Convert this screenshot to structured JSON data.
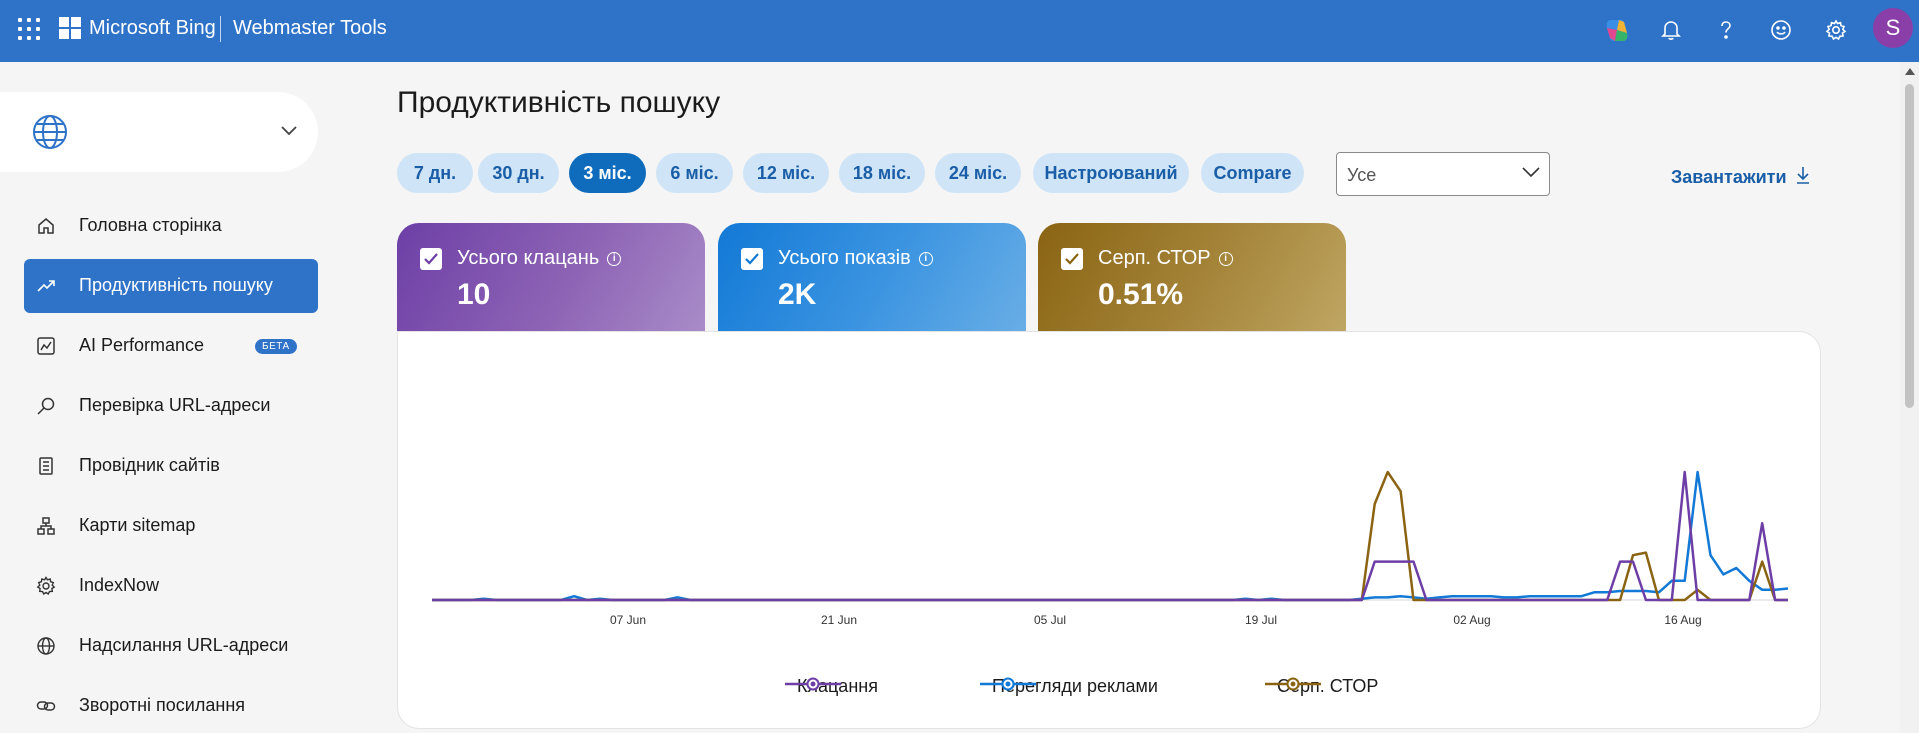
{
  "header": {
    "brand": "Microsoft Bing",
    "product": "Webmaster Tools",
    "avatar_initial": "S",
    "icons": [
      "waffle-icon",
      "copilot-icon",
      "bell-icon",
      "help-icon",
      "feedback-smiley-icon",
      "settings-gear-icon"
    ]
  },
  "sidebar": {
    "site_selector_icon": "globe-icon",
    "items": [
      {
        "label": "Головна сторінка",
        "icon": "home-icon"
      },
      {
        "label": "Продуктивність пошуку",
        "icon": "trend-icon",
        "active": true
      },
      {
        "label": "AI Performance",
        "icon": "ai-performance-icon",
        "badge": "БЕТА"
      },
      {
        "label": "Перевірка URL-адреси",
        "icon": "search-icon"
      },
      {
        "label": "Провідник сайтів",
        "icon": "site-explorer-icon"
      },
      {
        "label": "Карти sitemap",
        "icon": "sitemap-icon"
      },
      {
        "label": "IndexNow",
        "icon": "gear-icon"
      },
      {
        "label": "Надсилання URL-адреси",
        "icon": "globe-icon"
      },
      {
        "label": "Зворотні посилання",
        "icon": "link-icon"
      }
    ]
  },
  "main": {
    "title": "Продуктивність пошуку",
    "ranges": [
      "7 дн.",
      "30 дн.",
      "3 міс.",
      "6 міс.",
      "12 міс.",
      "18 міс.",
      "24 міс.",
      "Настроюваний",
      "Compare"
    ],
    "active_range": "3 міс.",
    "filter_value": "Усе",
    "download_label": "Завантажити",
    "metrics": [
      {
        "label": "Усього клацань",
        "value": "10",
        "checked": true,
        "color": "#6d3fa6"
      },
      {
        "label": "Усього показів",
        "value": "2K",
        "checked": true,
        "color": "#1279d6"
      },
      {
        "label": "Серп. СТОР",
        "value": "0.51%",
        "checked": true,
        "color": "#8a6413"
      }
    ]
  },
  "chart_data": {
    "type": "line",
    "x_ticks": [
      "07 Jun",
      "21 Jun",
      "05 Jul",
      "19 Jul",
      "02 Aug",
      "16 Aug"
    ],
    "grid": false,
    "legend_position": "bottom-center",
    "series": [
      {
        "name": "Клацання",
        "color": "#6d3fa6",
        "values": [
          0,
          0,
          0,
          0,
          0,
          0,
          0,
          0,
          0,
          0,
          0,
          0,
          0,
          0,
          0,
          0,
          0,
          0,
          0,
          0,
          0,
          0,
          0,
          0,
          0,
          0,
          0,
          0,
          0,
          0,
          0,
          0,
          0,
          0,
          0,
          0,
          0,
          0,
          0,
          0,
          0,
          0,
          0,
          0,
          0,
          0,
          0,
          0,
          0,
          0,
          0,
          0,
          0,
          0,
          0,
          0,
          0,
          0,
          0,
          0,
          0,
          0,
          0,
          0,
          0,
          0,
          0,
          0,
          0,
          0,
          0,
          0,
          0,
          0.3,
          0.3,
          0.3,
          0.3,
          0,
          0,
          0,
          0,
          0,
          0,
          0,
          0,
          0,
          0,
          0,
          0,
          0,
          0,
          0,
          0.3,
          0.3,
          0,
          0,
          0,
          1,
          0,
          0,
          0,
          0,
          0,
          0.6,
          0,
          0
        ]
      },
      {
        "name": "Перегляди реклами",
        "color": "#1279d6",
        "values": [
          0,
          0,
          0,
          0,
          0.01,
          0,
          0,
          0,
          0,
          0,
          0,
          0.03,
          0,
          0.01,
          0,
          0,
          0,
          0,
          0,
          0.02,
          0,
          0,
          0,
          0,
          0,
          0,
          0,
          0,
          0,
          0,
          0,
          0,
          0,
          0,
          0,
          0,
          0,
          0,
          0,
          0,
          0,
          0,
          0,
          0,
          0,
          0,
          0,
          0,
          0,
          0,
          0,
          0,
          0,
          0,
          0,
          0,
          0,
          0,
          0,
          0,
          0,
          0,
          0,
          0.01,
          0,
          0.01,
          0,
          0,
          0,
          0,
          0,
          0,
          0.01,
          0.02,
          0.02,
          0.03,
          0.02,
          0.01,
          0.02,
          0.03,
          0.03,
          0.03,
          0.03,
          0.02,
          0.02,
          0.03,
          0.03,
          0.03,
          0.03,
          0.03,
          0.06,
          0.06,
          0.07,
          0.07,
          0.07,
          0.06,
          0.15,
          0.15,
          1,
          0.35,
          0.2,
          0.25,
          0.15,
          0.08,
          0.08,
          0.09
        ]
      },
      {
        "name": "Серп. СТОР",
        "color": "#8a6413",
        "values": [
          0,
          0,
          0,
          0,
          0,
          0,
          0,
          0,
          0,
          0,
          0,
          0,
          0,
          0,
          0,
          0,
          0,
          0,
          0,
          0,
          0,
          0,
          0,
          0,
          0,
          0,
          0,
          0,
          0,
          0,
          0,
          0,
          0,
          0,
          0,
          0,
          0,
          0,
          0,
          0,
          0,
          0,
          0,
          0,
          0,
          0,
          0,
          0,
          0,
          0,
          0,
          0,
          0,
          0,
          0,
          0,
          0,
          0,
          0,
          0,
          0,
          0,
          0,
          0,
          0,
          0,
          0,
          0,
          0,
          0,
          0,
          0,
          0,
          0.75,
          1,
          0.85,
          0,
          0,
          0,
          0,
          0,
          0,
          0,
          0,
          0,
          0,
          0,
          0,
          0,
          0,
          0,
          0,
          0,
          0.35,
          0.37,
          0,
          0,
          0,
          0.08,
          0,
          0,
          0,
          0,
          0.3,
          0,
          0
        ]
      }
    ]
  }
}
